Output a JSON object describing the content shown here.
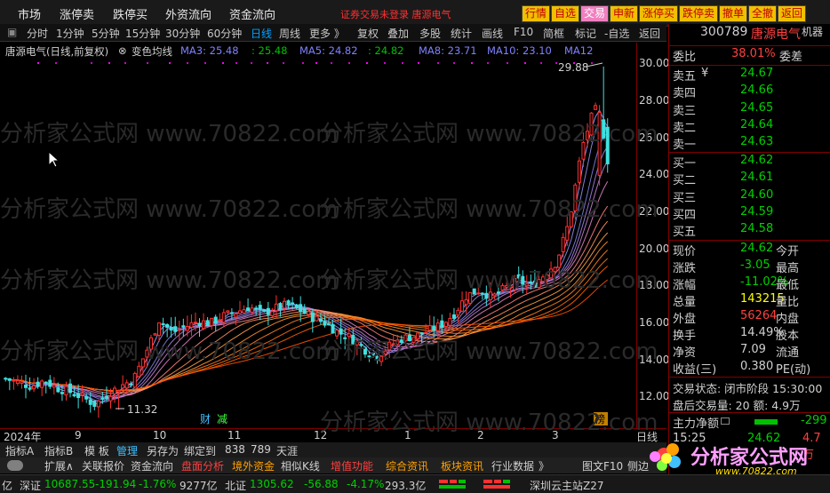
{
  "topbar": {
    "menus": [
      "市场",
      "涨停卖",
      "跌停买",
      "外资流向",
      "资金流向"
    ],
    "notice": "证券交易未登录  唐源电气",
    "buttons": [
      "行情",
      "自选",
      "交易",
      "申新",
      "涨停买",
      "跌停卖",
      "撤单",
      "全撤",
      "返回"
    ]
  },
  "periodbar": {
    "items": [
      "分时",
      "1分钟",
      "5分钟",
      "15分钟",
      "30分钟",
      "60分钟",
      "日线",
      "周线",
      "更多 》",
      "复权",
      "叠加",
      "多股",
      "统计",
      "画线",
      "F10",
      "简框",
      "标记",
      "-自选",
      "返回"
    ],
    "active": "日线"
  },
  "legend": {
    "title": "唐源电气(日线,前复权)",
    "indicator": "变色均线",
    "ma3": "MA3: 25.48",
    "ma3b": ": 25.48",
    "ma5": "MA5: 24.82",
    "ma5b": ": 24.82",
    "ma8": "MA8: 23.71",
    "ma10": "MA10: 23.10",
    "ma12": "MA12"
  },
  "chart_annotations": {
    "high": "29.88",
    "low": "11.32",
    "badge1": "财",
    "badge2": "减",
    "badge3": "榜"
  },
  "yaxis": {
    "ticks": [
      "30.00",
      "28.00",
      "26.00",
      "24.00",
      "22.00",
      "20.00",
      "18.00",
      "16.00",
      "14.00",
      "12.00"
    ]
  },
  "xaxis": {
    "labels": [
      "2024年",
      "9",
      "10",
      "11",
      "12",
      "1",
      "2",
      "3",
      "日线"
    ]
  },
  "tabbar1": {
    "items": [
      "指标A",
      "指标B",
      "模 板",
      "管理",
      "另存为",
      "绑定到",
      "838",
      "789",
      "天涯"
    ]
  },
  "tabbar2": {
    "items": [
      "扩展∧",
      "关联报价",
      "资金流向",
      "盘面分析",
      "境外资金",
      "相似K线",
      "增值功能",
      "综合资讯",
      "板块资讯",
      "行业数据",
      "》",
      "图文F10",
      "侧边"
    ]
  },
  "statusbar": {
    "prefix": "亿",
    "sz_label": "深证",
    "sz_value": "10687.55",
    "sz_change": "-191.94",
    "sz_pct": "-1.76%",
    "sz_amount": "9277亿",
    "bz_label": "北证",
    "bz_value": "1305.62",
    "bz_change": "-56.88",
    "bz_pct": "-4.17%",
    "bz_amount": "293.3亿",
    "server": "深圳云主站Z27"
  },
  "rightpanel": {
    "code": "300789",
    "name": "唐源电气",
    "tag": "机器",
    "weibi_label": "委比",
    "weibi_value": "38.01%",
    "weicha_label": "委差",
    "asks": [
      {
        "label": "卖五",
        "price": "24.67"
      },
      {
        "label": "卖四",
        "price": "24.66"
      },
      {
        "label": "卖三",
        "price": "24.65"
      },
      {
        "label": "卖二",
        "price": "24.64"
      },
      {
        "label": "卖一",
        "price": "24.63"
      }
    ],
    "bids": [
      {
        "label": "买一",
        "price": "24.62"
      },
      {
        "label": "买二",
        "price": "24.61"
      },
      {
        "label": "买三",
        "price": "24.60"
      },
      {
        "label": "买四",
        "price": "24.59"
      },
      {
        "label": "买五",
        "price": "24.58"
      }
    ],
    "stats": [
      {
        "label": "现价",
        "value": "24.62",
        "right": "今开",
        "color": "green"
      },
      {
        "label": "涨跌",
        "value": "-3.05",
        "right": "最高",
        "color": "green"
      },
      {
        "label": "涨幅",
        "value": "-11.02%",
        "right": "最低",
        "color": "green"
      },
      {
        "label": "总量",
        "value": "143215",
        "right": "量比",
        "color": "yellow"
      },
      {
        "label": "外盘",
        "value": "56264",
        "right": "内盘",
        "color": "red"
      },
      {
        "label": "换手",
        "value": "14.49%",
        "right": "股本",
        "color": "white"
      },
      {
        "label": "净资",
        "value": "7.09",
        "right": "流通",
        "color": "white"
      },
      {
        "label": "收益(三)",
        "value": "0.380",
        "right": "PE(动)",
        "color": "white"
      }
    ],
    "trade_status": "交易状态: 闭市阶段 15:30:00",
    "after_hours": "盘后交易量: 20  额: 4.9万",
    "main_flow_label": "主力净额",
    "main_flow_value": "-299",
    "last_time": "15:25",
    "last_price": "24.62",
    "last_vol": "4.7万"
  },
  "logo_text": "分析家公式网",
  "logo_url": "www.70822.com",
  "watermark": "分析家公式网 www.70822.com",
  "colors": {
    "up": "#ff4040",
    "down": "#00d000",
    "candle_up": "#ff3030",
    "candle_down": "#40e0e0",
    "accent": "#00a0ff"
  },
  "chart_data": {
    "type": "candlestick",
    "ylim": [
      11.0,
      30.5
    ],
    "yticks": [
      30,
      28,
      26,
      24,
      22,
      20,
      18,
      16,
      14,
      12
    ],
    "x": [
      "2024-08",
      "2024-09",
      "2024-10",
      "2024-11",
      "2024-12",
      "2025-01",
      "2025-02",
      "2025-03"
    ],
    "close_path": [
      13.0,
      12.8,
      12.6,
      12.9,
      12.5,
      12.3,
      12.0,
      11.6,
      12.2,
      12.6,
      13.0,
      14.5,
      16.2,
      15.5,
      15.8,
      16.1,
      16.0,
      16.4,
      16.6,
      16.9,
      16.5,
      16.8,
      17.0,
      16.7,
      16.3,
      16.0,
      15.5,
      15.2,
      14.6,
      14.2,
      14.8,
      15.2,
      15.3,
      15.6,
      15.9,
      16.5,
      17.5,
      17.8,
      17.4,
      17.9,
      18.3,
      18.0,
      18.6,
      19.3,
      21.5,
      25.5,
      27.7,
      24.62
    ],
    "high": 29.88,
    "low": 11.32
  }
}
